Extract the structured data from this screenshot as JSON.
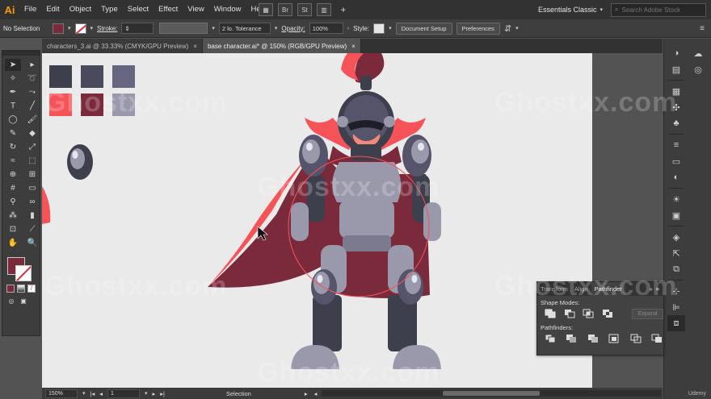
{
  "app": {
    "logo": "Ai"
  },
  "menu": [
    "File",
    "Edit",
    "Object",
    "Type",
    "Select",
    "Effect",
    "View",
    "Window",
    "Help"
  ],
  "menu_right": {
    "icon_st": "St",
    "workspace": "Essentials Classic",
    "search_placeholder": "Search Adobe Stock"
  },
  "control": {
    "selection": "No Selection",
    "stroke_label": "Stroke:",
    "brush_value": "2 lo. Tolerance",
    "opacity_label": "Opacity:",
    "opacity_value": "100%",
    "style_label": "Style:",
    "document_setup": "Document Setup",
    "preferences": "Preferences",
    "fill_color": "#7b2a3b"
  },
  "tabs": [
    {
      "label": "characters_3.ai @ 33.33% (CMYK/GPU Preview)",
      "close": "×"
    },
    {
      "label": "base character.ai* @ 150% (RGB/GPU Preview)",
      "close": "×"
    }
  ],
  "status": {
    "zoom": "150%",
    "artboard": "1",
    "mode": "Selection"
  },
  "pathfinder": {
    "tabs": [
      "Transform",
      "Align",
      "Pathfinder"
    ],
    "shape_modes_label": "Shape Modes:",
    "pathfinders_label": "Pathfinders:",
    "expand": "Expand"
  },
  "swatches": [
    "#3e3f4c",
    "#4a4a5e",
    "#676680",
    "#f65358",
    "#7b2a3b",
    "#9a98ab"
  ],
  "watermark": "Ghostxx.com",
  "udemy": "Udemy",
  "colors": {
    "armor_dark": "#3e3f4c",
    "armor_mid": "#55546a",
    "armor_light": "#9a98ab",
    "armor_lighter": "#b7b5c6",
    "cape_red": "#f65358",
    "cape_dark": "#7b2a3b",
    "skin": "#f28a7a"
  }
}
